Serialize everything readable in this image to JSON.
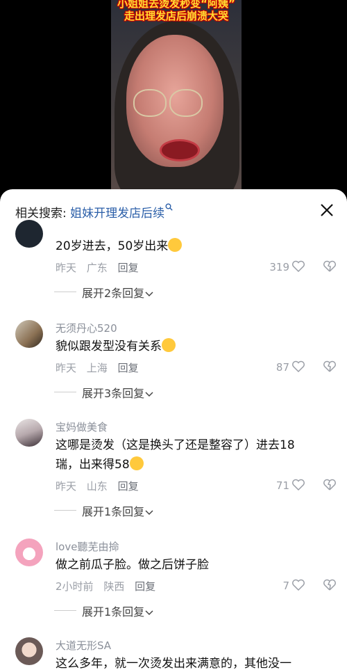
{
  "video": {
    "caption_line1": "小姐姐去烫发秒变“阿姨”",
    "caption_line2": "走出理发店后崩溃大哭"
  },
  "header": {
    "related_label": "相关搜索:",
    "related_query": "姐妹开理发店后续"
  },
  "comments": [
    {
      "username": "",
      "text": "20岁进去，50岁出来",
      "time": "昨天",
      "location": "广东",
      "reply": "回复",
      "likes": "319",
      "expand": "展开2条回复"
    },
    {
      "username": "无须丹心520",
      "text": "貌似跟发型没有关系",
      "time": "昨天",
      "location": "上海",
      "reply": "回复",
      "likes": "87",
      "expand": "展开3条回复"
    },
    {
      "username": "宝妈做美食",
      "text_line1": "这哪是烫发（这是换头了还是整容了）进去18",
      "text_line2": "瑞，出来得58",
      "time": "昨天",
      "location": "山东",
      "reply": "回复",
      "likes": "71",
      "expand": "展开1条回复"
    },
    {
      "username": "love聽芜由掵",
      "text": "做之前瓜子脸。做之后饼子脸",
      "time": "2小时前",
      "location": "陕西",
      "reply": "回复",
      "likes": "7",
      "expand": "展开1条回复"
    },
    {
      "username": "大道无形SA",
      "text": "这么多年，就一次烫发出来满意的，其他没一"
    }
  ],
  "icons": {
    "heart": "heart-icon",
    "dislike": "broken-heart-icon",
    "chevron": "chevron-down-icon",
    "search": "search-icon",
    "close": "close-icon"
  }
}
